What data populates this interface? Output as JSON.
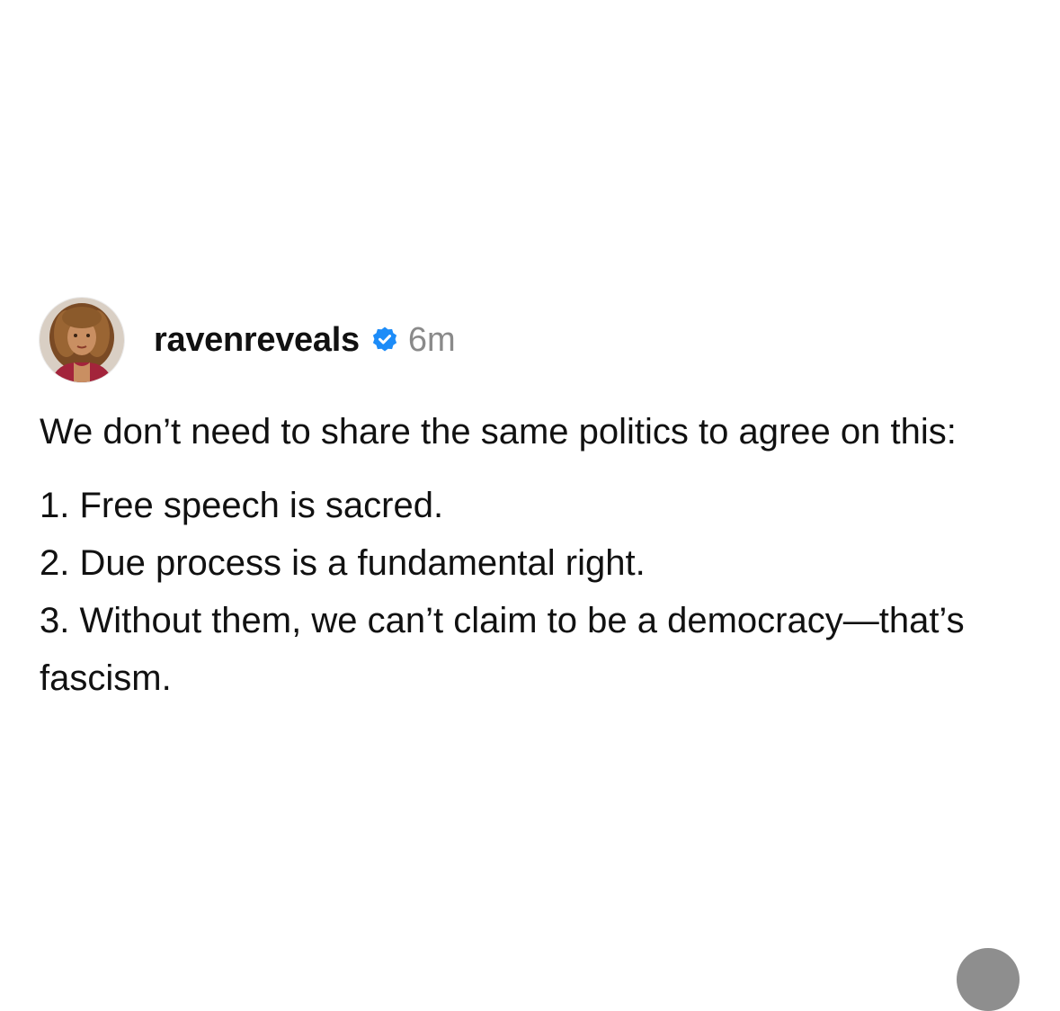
{
  "post": {
    "username": "ravenreveals",
    "verified_icon": "verified-badge-icon",
    "verified_color": "#1d8cf8",
    "timestamp": "6m",
    "intro": "We don’t need to share the same politics to agree on this:",
    "list": [
      "1. Free speech is sacred.",
      "2. Due process is a fundamental right.",
      "3. Without them, we can’t claim to be a democracy—that’s fascism."
    ]
  },
  "colors": {
    "text": "#111111",
    "muted": "#8a8a8a",
    "background": "#ffffff",
    "corner_button": "#8e8e8e"
  }
}
